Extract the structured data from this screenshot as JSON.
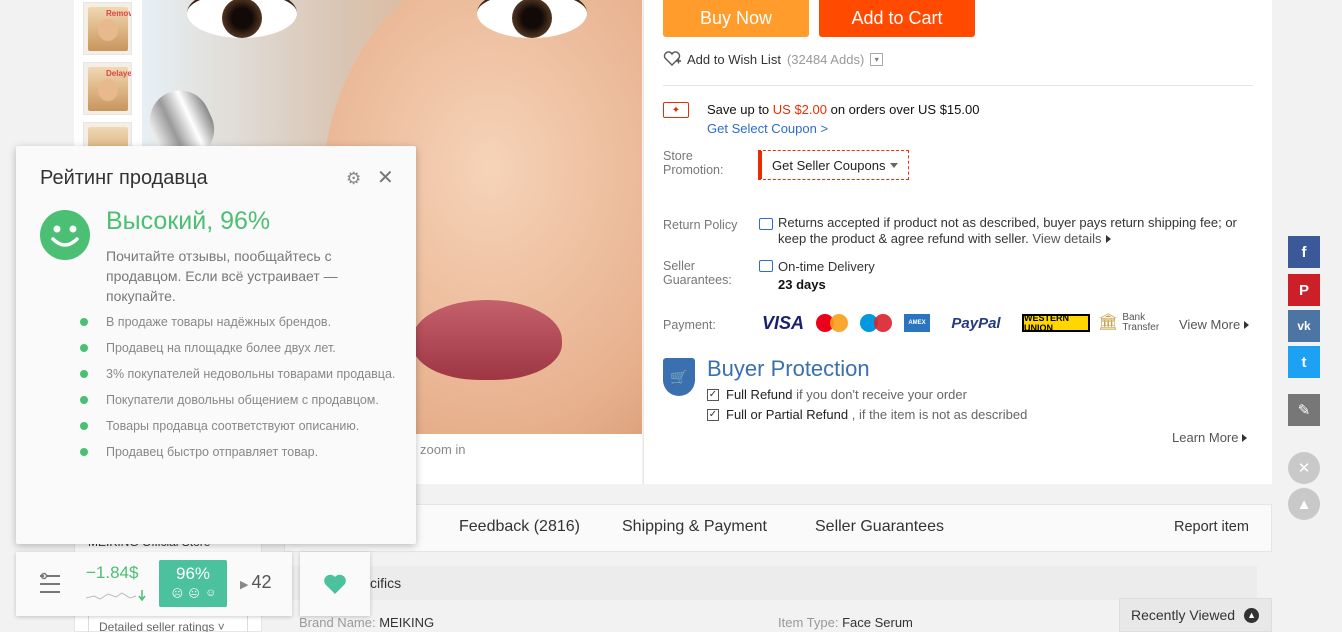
{
  "gallery": {
    "thumbs": [
      "Remove",
      "Delayed",
      ""
    ],
    "zoom_hint": "zoom in"
  },
  "actions": {
    "buy_now": "Buy Now",
    "add_to_cart": "Add to Cart",
    "wish_label": "Add to Wish List",
    "wish_count": "(32484 Adds)"
  },
  "coupon": {
    "save_prefix": "Save up to ",
    "save_amount": "US $2.00",
    "save_suffix": " on orders over US $15.00",
    "get_select": "Get Select Coupon >",
    "store_promo_label": "Store Promotion:",
    "store_promo_btn": "Get Seller Coupons"
  },
  "return_policy": {
    "label": "Return Policy",
    "text": "Returns accepted if product not as described, buyer pays return shipping fee; or keep the product & agree refund with seller.",
    "view_details": "View details"
  },
  "guarantees": {
    "label": "Seller Guarantees:",
    "delivery": "On-time Delivery",
    "days": "23 days"
  },
  "payment": {
    "label": "Payment:",
    "methods": [
      "VISA",
      "MasterCard",
      "Maestro",
      "AMERICAN EXPRESS",
      "PayPal",
      "WESTERN UNION",
      "Bank Transfer"
    ],
    "view_more": "View More"
  },
  "buyer_protection": {
    "title": "Buyer Protection",
    "item1_bold": "Full Refund",
    "item1_rest": " if you don't receive your order",
    "item2_bold": "Full or Partial Refund",
    "item2_rest": " , if the item is not as described",
    "learn_more": "Learn More"
  },
  "tabs": {
    "feedback": "Feedback (2816)",
    "shipping": "Shipping & Payment",
    "seller_guarantees": "Seller Guarantees",
    "report": "Report item",
    "spec_title": "cifics",
    "brand_label": "Brand Name: ",
    "brand_value": "MEIKING",
    "type_label": "Item Type: ",
    "type_value": "Face Serum",
    "recently_viewed": "Recently Viewed"
  },
  "store": {
    "name": "MEIKING Official Store",
    "ratings": "Detailed seller ratings"
  },
  "popup": {
    "title": "Рейтинг продавца",
    "rating": "Высокий, 96%",
    "description": "Почитайте отзывы, пообщайтесь с продавцом. Если всё устраивает — покупайте.",
    "bullets": [
      "В продаже товары надёжных брендов.",
      "Продавец на площадке более двух лет.",
      "3% покупателей недовольны товарами продавца.",
      "Покупатели довольны общением с продавцом.",
      "Товары продавца соответствуют описанию.",
      "Продавец быстро отправляет товар."
    ]
  },
  "extension": {
    "price_diff": "−1.84$",
    "percent": "96%",
    "count": "42"
  },
  "social": [
    "f",
    "P",
    "vk",
    "t",
    "edit"
  ],
  "colors": {
    "buy_now": "#ff9c2b",
    "add_to_cart": "#ff4a00",
    "accent_green": "#4bbf73",
    "badge_teal": "#4bc19e",
    "protection_blue": "#3a6fb0",
    "coupon_red": "#e62e04"
  }
}
